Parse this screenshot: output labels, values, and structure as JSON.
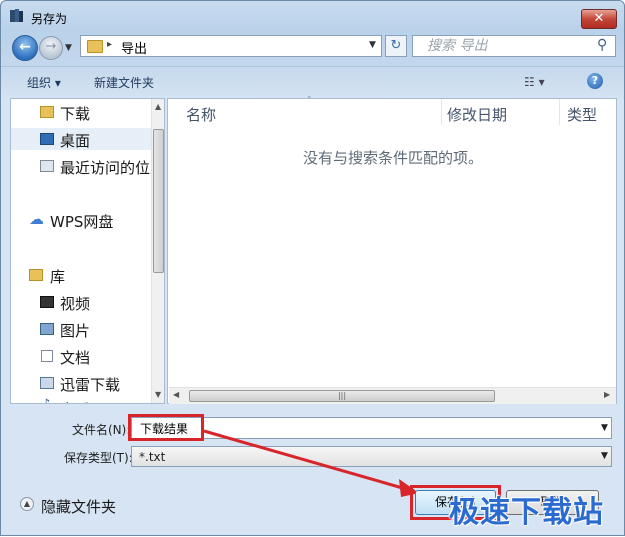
{
  "window": {
    "title": "另存为",
    "close_label": "✕"
  },
  "navbar": {
    "path_label": "导出",
    "search_placeholder": "搜索 导出"
  },
  "toolbar": {
    "organize": "组织 ▾",
    "new_folder": "新建文件夹",
    "view": "☷ ▾",
    "help": "?"
  },
  "nav_items": [
    {
      "label": "下载",
      "icon": "folder-download-icon"
    },
    {
      "label": "桌面",
      "icon": "desktop-icon"
    },
    {
      "label": "最近访问的位置",
      "icon": "recent-places-icon"
    },
    {
      "label": "WPS网盘",
      "icon": "cloud-icon"
    },
    {
      "label": "库",
      "icon": "library-icon"
    },
    {
      "label": "视频",
      "icon": "video-icon"
    },
    {
      "label": "图片",
      "icon": "picture-icon"
    },
    {
      "label": "文档",
      "icon": "document-icon"
    },
    {
      "label": "迅雷下载",
      "icon": "thunder-download-icon"
    },
    {
      "label": "音乐",
      "icon": "music-icon"
    }
  ],
  "file_list": {
    "columns": [
      "名称",
      "修改日期",
      "类型"
    ],
    "empty_message": "没有与搜索条件匹配的项。"
  },
  "form": {
    "filename_label": "文件名(N):",
    "filename_value": "下载结果",
    "filetype_label": "保存类型(T):",
    "filetype_value": "*.txt"
  },
  "footer": {
    "hide_folders": "隐藏文件夹",
    "save": "保存(S)",
    "cancel": "取消"
  },
  "watermark": "极速下载站",
  "colors": {
    "highlight": "#d8252b",
    "accent": "#2b6bd0"
  }
}
